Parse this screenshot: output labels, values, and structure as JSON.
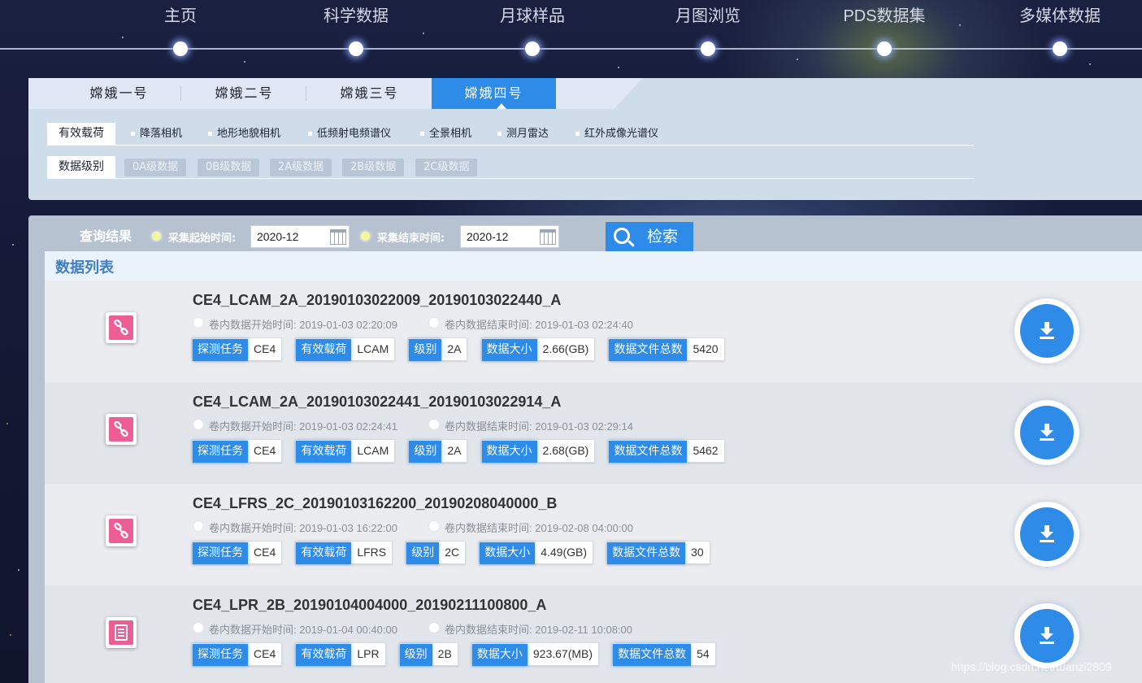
{
  "nav": {
    "items": [
      {
        "label": "主页"
      },
      {
        "label": "科学数据"
      },
      {
        "label": "月球样品"
      },
      {
        "label": "月图浏览"
      },
      {
        "label": "PDS数据集"
      },
      {
        "label": "多媒体数据"
      }
    ],
    "active_index": 4
  },
  "mission_tabs": [
    "嫦娥一号",
    "嫦娥二号",
    "嫦娥三号",
    "嫦娥四号"
  ],
  "active_tab": "嫦娥四号",
  "filters": {
    "payload_label": "有效载荷",
    "payloads": [
      "降落相机",
      "地形地貌相机",
      "低频射电频谱仪",
      "全景相机",
      "测月雷达",
      "红外成像光谱仪"
    ],
    "level_label": "数据级别",
    "levels": [
      "0A级数据",
      "0B级数据",
      "2A级数据",
      "2B级数据",
      "2C级数据"
    ]
  },
  "query": {
    "title": "查询结果",
    "start_label": "采集起始时间:",
    "start_value": "2020-12",
    "end_label": "采集结束时间:",
    "end_value": "2020-12",
    "search_label": "检索"
  },
  "list": {
    "title": "数据列表",
    "start_prefix": "卷内数据开始时间:",
    "end_prefix": "卷内数据结束时间:",
    "tag_mission": "探测任务",
    "tag_payload": "有效载荷",
    "tag_level": "级别",
    "tag_size": "数据大小",
    "tag_count": "数据文件总数",
    "rows": [
      {
        "title": "CE4_LCAM_2A_20190103022009_20190103022440_A",
        "start": "2019-01-03 02:20:09",
        "end": "2019-01-03 02:24:40",
        "mission": "CE4",
        "payload": "LCAM",
        "level": "2A",
        "size": "2.66(GB)",
        "count": "5420",
        "icon": "link-icon"
      },
      {
        "title": "CE4_LCAM_2A_20190103022441_20190103022914_A",
        "start": "2019-01-03 02:24:41",
        "end": "2019-01-03 02:29:14",
        "mission": "CE4",
        "payload": "LCAM",
        "level": "2A",
        "size": "2.68(GB)",
        "count": "5462",
        "icon": "link-icon"
      },
      {
        "title": "CE4_LFRS_2C_20190103162200_20190208040000_B",
        "start": "2019-01-03 16:22:00",
        "end": "2019-02-08 04:00:00",
        "mission": "CE4",
        "payload": "LFRS",
        "level": "2C",
        "size": "4.49(GB)",
        "count": "30",
        "icon": "link-icon"
      },
      {
        "title": "CE4_LPR_2B_20190104004000_20190211100800_A",
        "start": "2019-01-04 00:40:00",
        "end": "2019-02-11 10:08:00",
        "mission": "CE4",
        "payload": "LPR",
        "level": "2B",
        "size": "923.67(MB)",
        "count": "54",
        "icon": "document-icon"
      }
    ]
  },
  "watermark": "https://blog.csdn.net/tuanzi2809",
  "colors": {
    "accent": "#2f8be8",
    "file_icon": "#ec5e94"
  }
}
